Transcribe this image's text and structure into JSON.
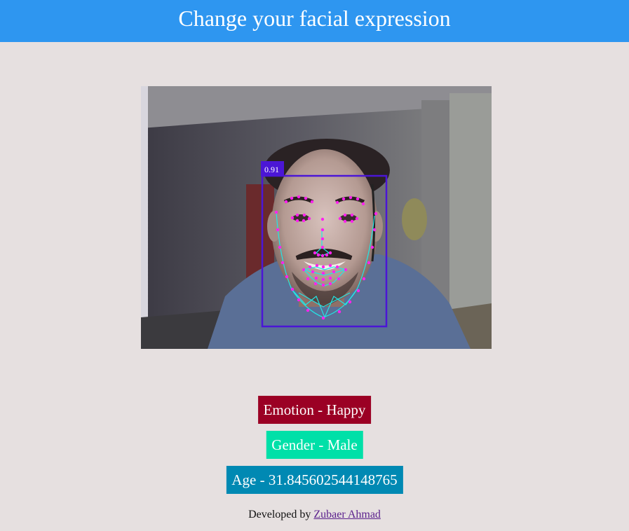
{
  "header": {
    "title": "Change your facial expression"
  },
  "video": {
    "detection_score": "0.91"
  },
  "results": {
    "emotion": "Emotion - Happy",
    "gender": "Gender - Male",
    "age": "Age - 31.845602544148765"
  },
  "footer": {
    "prefix": "Developed by ",
    "author": "Zubaer Ahmad"
  },
  "colors": {
    "header_bg": "#2e96f0",
    "page_bg": "#e6e0e0",
    "emotion_bg": "#9b0024",
    "gender_bg": "#00e0a8",
    "age_bg": "#0089b3",
    "box_color": "#4b16d6",
    "landmark_color": "#ff22ee",
    "mesh_color": "#22e6e6"
  }
}
